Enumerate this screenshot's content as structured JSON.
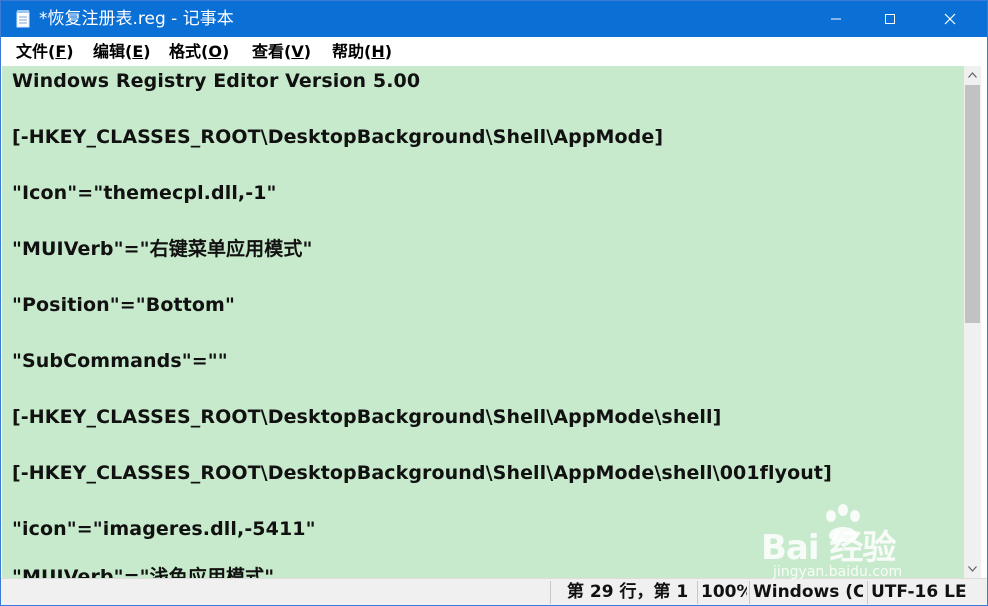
{
  "window": {
    "title": "*恢复注册表.reg - 记事本"
  },
  "menu": [
    {
      "label": "文件(",
      "accel": "F",
      "suffix": ")"
    },
    {
      "label": "编辑(",
      "accel": "E",
      "suffix": ")"
    },
    {
      "label": "格式(",
      "accel": "O",
      "suffix": ")"
    },
    {
      "label": "查看(",
      "accel": "V",
      "suffix": ")"
    },
    {
      "label": "帮助(",
      "accel": "H",
      "suffix": ")"
    }
  ],
  "editor": {
    "background": "#c8eacc",
    "lines": [
      "Windows Registry Editor Version 5.00",
      "",
      "[-HKEY_CLASSES_ROOT\\DesktopBackground\\Shell\\AppMode]",
      "",
      "\"Icon\"=\"themecpl.dll,-1\"",
      "",
      "\"MUIVerb\"=\"右键菜单应用模式\"",
      "",
      "\"Position\"=\"Bottom\"",
      "",
      "\"SubCommands\"=\"\"",
      "",
      "[-HKEY_CLASSES_ROOT\\DesktopBackground\\Shell\\AppMode\\shell]",
      "",
      "[-HKEY_CLASSES_ROOT\\DesktopBackground\\Shell\\AppMode\\shell\\001flyout]",
      "",
      "\"icon\"=\"imageres.dll,-5411\"",
      "",
      "\"MUIVerb\"=\"浅色应用模式\""
    ]
  },
  "statusbar": {
    "position": "第 29 行，第 1",
    "zoom": "100%",
    "line_ending": "Windows (CRLF)",
    "encoding": "UTF-16 LE"
  },
  "watermark": {
    "brand": "Bai  经验",
    "url": "jingyan.baidu.com"
  },
  "colors": {
    "titlebar": "#0b70d6",
    "editor_bg": "#c8eacc",
    "statusbar": "#f0f0f0"
  }
}
